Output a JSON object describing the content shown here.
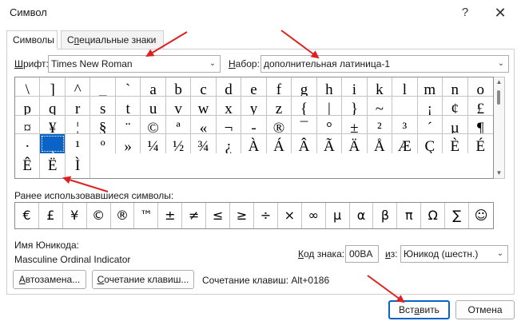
{
  "window": {
    "title": "Символ",
    "help_icon": "?",
    "close_icon": "✕"
  },
  "tabs": [
    {
      "label": "Символы",
      "active": true
    },
    {
      "label_prefix": "С",
      "label_ul": "п",
      "label_rest": "ециальные знаки",
      "active": false
    }
  ],
  "font": {
    "label_ul": "Ш",
    "label_rest": "рифт:",
    "value": "Times New Roman"
  },
  "subset": {
    "label_ul": "Н",
    "label_rest": "абор:",
    "value": "дополнительная латиница-1"
  },
  "symbols": [
    "\\",
    "]",
    "^",
    "_",
    "`",
    "a",
    "b",
    "c",
    "d",
    "e",
    "f",
    "g",
    "h",
    "i",
    "k",
    "l",
    "m",
    "n",
    "o",
    "p",
    "q",
    "r",
    "s",
    "t",
    "u",
    "v",
    "w",
    "x",
    "y",
    "z",
    "{",
    "|",
    "}",
    "~",
    "",
    "¡",
    "¢",
    "£",
    "¤",
    "¥",
    "¦",
    "§",
    "¨",
    "©",
    "ª",
    "«",
    "¬",
    "-",
    "®",
    "¯",
    "°",
    "±",
    "²",
    "³",
    "´",
    "µ",
    "¶",
    "·",
    "¸",
    "¹",
    "º",
    "»",
    "¼",
    "½",
    "¾",
    "¿",
    "À",
    "Á",
    "Â",
    "Ã",
    "Ä",
    "Å",
    "Æ",
    "Ç",
    "È",
    "É",
    "Ê",
    "Ë",
    "Ì"
  ],
  "selected_index": 58,
  "recent": {
    "label": "Ранее использовавшиеся символы:",
    "symbols": [
      "€",
      "£",
      "¥",
      "©",
      "®",
      "™",
      "±",
      "≠",
      "≤",
      "≥",
      "÷",
      "×",
      "∞",
      "µ",
      "α",
      "β",
      "π",
      "Ω",
      "∑",
      "☺"
    ]
  },
  "unicode_name": {
    "label": "Имя Юникода:",
    "value": "Masculine Ordinal Indicator"
  },
  "char_code": {
    "label_ul": "К",
    "label_rest": "од знака:",
    "value": "00BA"
  },
  "from": {
    "label_ul": "и",
    "label_rest": "з:",
    "value": "Юникод (шестн.)"
  },
  "autocorrect_button": {
    "prefix": "",
    "ul": "А",
    "rest": "втозамена..."
  },
  "shortcut_button": {
    "prefix": "",
    "ul": "С",
    "rest": "очетание клавиш..."
  },
  "shortcut_text": "Сочетание клавиш: Alt+0186",
  "insert_button": {
    "prefix": "Вст",
    "ul": "а",
    "rest": "вить"
  },
  "cancel_button": "Отмена",
  "colors": {
    "selection": "#0a64c8",
    "annotation_arrow": "#e02020"
  }
}
